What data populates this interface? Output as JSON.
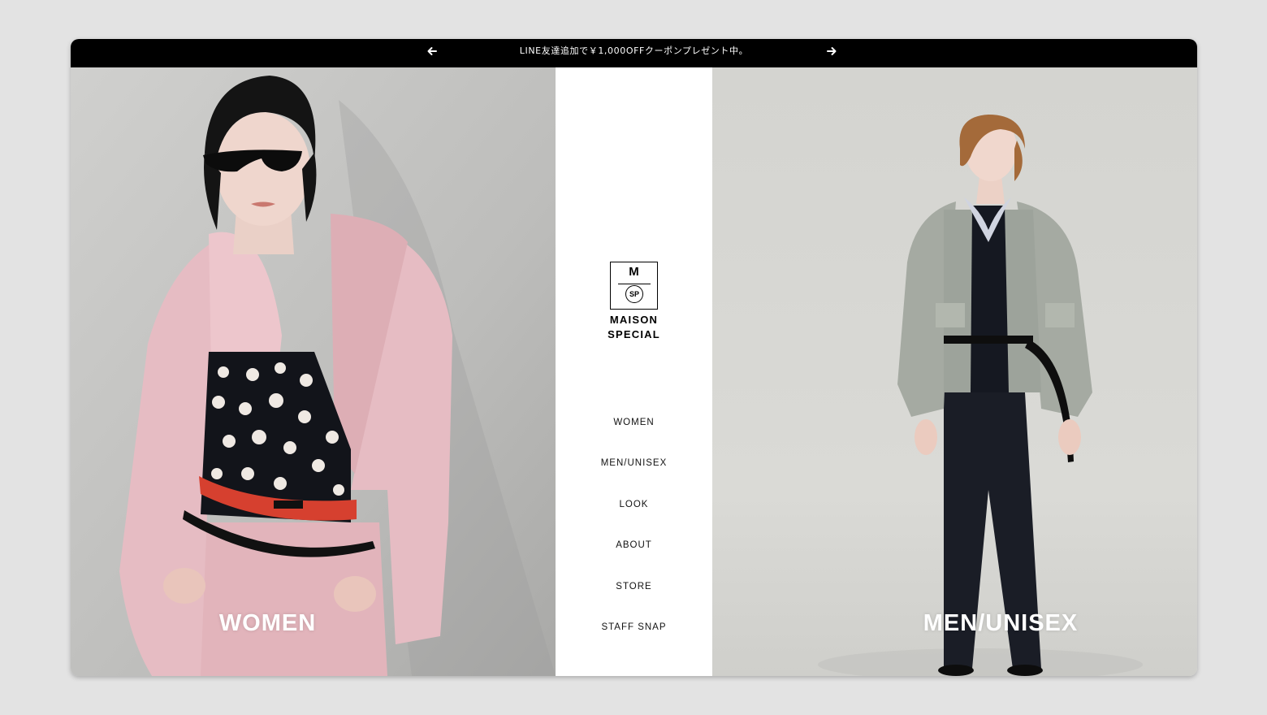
{
  "announcement": {
    "text": "LINE友達追加で￥1,000OFFクーポンプレゼント中。",
    "prev_icon": "arrow-left-icon",
    "next_icon": "arrow-right-icon"
  },
  "panels": {
    "women": {
      "label": "WOMEN"
    },
    "men": {
      "label": "MEN/UNISEX"
    }
  },
  "logo": {
    "letter": "M",
    "circle": "SP",
    "line1": "MAISON",
    "line2": "SPECIAL"
  },
  "nav": {
    "items": [
      {
        "label": "WOMEN"
      },
      {
        "label": "MEN/UNISEX"
      },
      {
        "label": "LOOK"
      },
      {
        "label": "ABOUT"
      },
      {
        "label": "STORE"
      },
      {
        "label": "STAFF SNAP"
      }
    ]
  },
  "colors": {
    "bar": "#000000",
    "page_bg": "#e3e3e3",
    "blazer_pink": "#e4b8bf"
  }
}
